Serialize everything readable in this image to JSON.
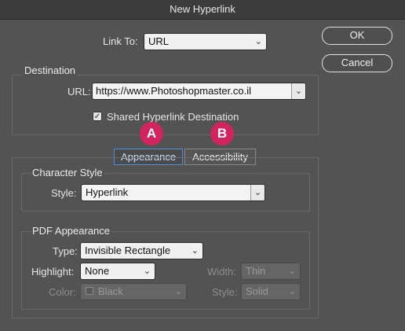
{
  "window": {
    "title": "New Hyperlink"
  },
  "link_to": {
    "label": "Link To:",
    "value": "URL"
  },
  "buttons": {
    "ok": "OK",
    "cancel": "Cancel"
  },
  "destination": {
    "title": "Destination",
    "url_label": "URL:",
    "url_value": "https://www.Photoshopmaster.co.il",
    "shared_label": "Shared Hyperlink Destination",
    "shared_checked": true
  },
  "badges": {
    "a": "A",
    "b": "B"
  },
  "tabs": [
    {
      "label": "Appearance",
      "active": true
    },
    {
      "label": "Accessibility",
      "active": false
    }
  ],
  "character_style": {
    "title": "Character Style",
    "style_label": "Style:",
    "style_value": "Hyperlink"
  },
  "pdf_appearance": {
    "title": "PDF Appearance",
    "type_label": "Type:",
    "type_value": "Invisible Rectangle",
    "highlight_label": "Highlight:",
    "highlight_value": "None",
    "color_label": "Color:",
    "color_value": "Black",
    "width_label": "Width:",
    "width_value": "Thin",
    "style_label": "Style:",
    "style_value": "Solid"
  },
  "colors": {
    "background": "#535353",
    "badge": "#d2245f",
    "active_tab_border": "#4a8ee0"
  }
}
